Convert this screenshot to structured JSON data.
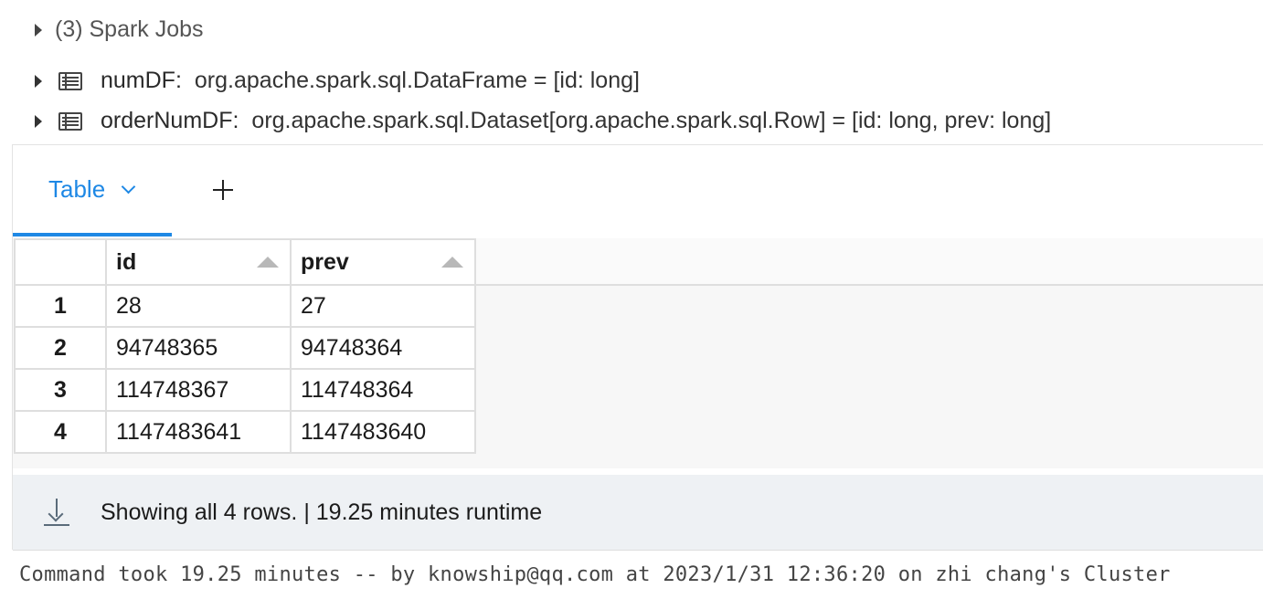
{
  "spark_jobs": {
    "label": "(3) Spark Jobs"
  },
  "dataframes": [
    {
      "name": "numDF:",
      "type": "org.apache.spark.sql.DataFrame = [id: long]"
    },
    {
      "name": "orderNumDF:",
      "type": "org.apache.spark.sql.Dataset[org.apache.spark.sql.Row] = [id: long, prev: long]"
    }
  ],
  "tabs": {
    "table_label": "Table",
    "add_icon": "plus-icon"
  },
  "table": {
    "columns": [
      "id",
      "prev"
    ],
    "rows": [
      {
        "index": "1",
        "id": "28",
        "prev": "27"
      },
      {
        "index": "2",
        "id": "94748365",
        "prev": "94748364"
      },
      {
        "index": "3",
        "id": "114748367",
        "prev": "114748364"
      },
      {
        "index": "4",
        "id": "1147483641",
        "prev": "1147483640"
      }
    ]
  },
  "footer": {
    "text": "Showing all 4 rows.  |  19.25 minutes runtime",
    "icon": "download-icon"
  },
  "command_info": "Command took 19.25 minutes -- by knowship@qq.com at 2023/1/31 12:36:20 on zhi chang's Cluster",
  "colors": {
    "accent": "#1e88e5",
    "footer_bg": "#eef1f4"
  }
}
